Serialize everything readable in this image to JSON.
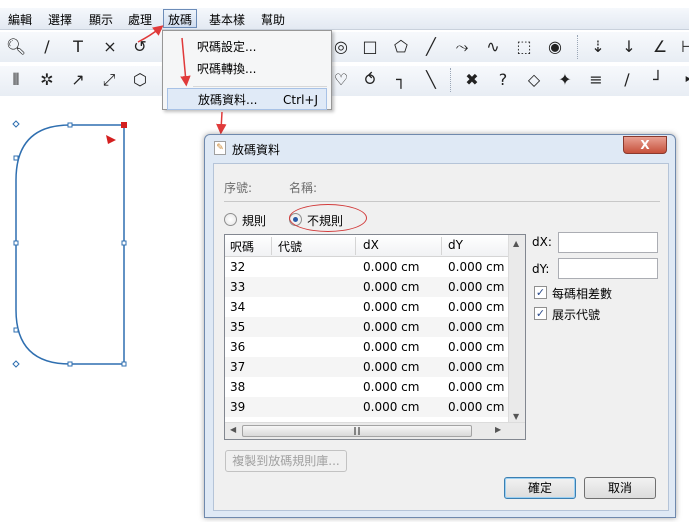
{
  "menubar": {
    "items": [
      "編輯",
      "選擇",
      "顯示",
      "處理",
      "放碼",
      "基本樣",
      "幫助"
    ]
  },
  "dropdown": {
    "items": [
      {
        "label": "呎碼設定...",
        "shortcut": ""
      },
      {
        "label": "呎碼轉換...",
        "shortcut": ""
      },
      {
        "label": "放碼資料...",
        "shortcut": "Ctrl+J"
      }
    ]
  },
  "toolbar_icons": [
    "zoom-icon",
    "ruler-icon",
    "text-icon",
    "cross-line-icon",
    "undo-curve-icon",
    "circle-icon",
    "rectangle-icon",
    "pentagon-icon",
    "line-icon",
    "curve-icon",
    "wave-icon",
    "dashed-rect-icon",
    "spiral-icon",
    "point-arrow-icon",
    "point-arrow-2-icon",
    "angle-icon"
  ],
  "dialog": {
    "title": "放碼資料",
    "close": "X",
    "size_label": "序號:",
    "name_label": "名稱:",
    "radio_regular": "規則",
    "radio_irregular": "不規則",
    "table": {
      "headers": [
        "呎碼",
        "代號",
        "dX",
        "dY"
      ],
      "rows": [
        {
          "size": "32",
          "code": "",
          "dx": "0.000 cm",
          "dy": "0.000 cm"
        },
        {
          "size": "33",
          "code": "",
          "dx": "0.000 cm",
          "dy": "0.000 cm"
        },
        {
          "size": "34",
          "code": "",
          "dx": "0.000 cm",
          "dy": "0.000 cm"
        },
        {
          "size": "35",
          "code": "",
          "dx": "0.000 cm",
          "dy": "0.000 cm"
        },
        {
          "size": "36",
          "code": "",
          "dx": "0.000 cm",
          "dy": "0.000 cm"
        },
        {
          "size": "37",
          "code": "",
          "dx": "0.000 cm",
          "dy": "0.000 cm"
        },
        {
          "size": "38",
          "code": "",
          "dx": "0.000 cm",
          "dy": "0.000 cm"
        },
        {
          "size": "39",
          "code": "",
          "dx": "0.000 cm",
          "dy": "0.000 cm"
        }
      ]
    },
    "dx_label": "dX:",
    "dy_label": "dY:",
    "dx_value": "",
    "dy_value": "",
    "check_each_size": "每碼相差數",
    "check_show_code": "展示代號",
    "copy_button": "複製到放碼規則庫...",
    "ok_button": "確定",
    "cancel_button": "取消"
  }
}
